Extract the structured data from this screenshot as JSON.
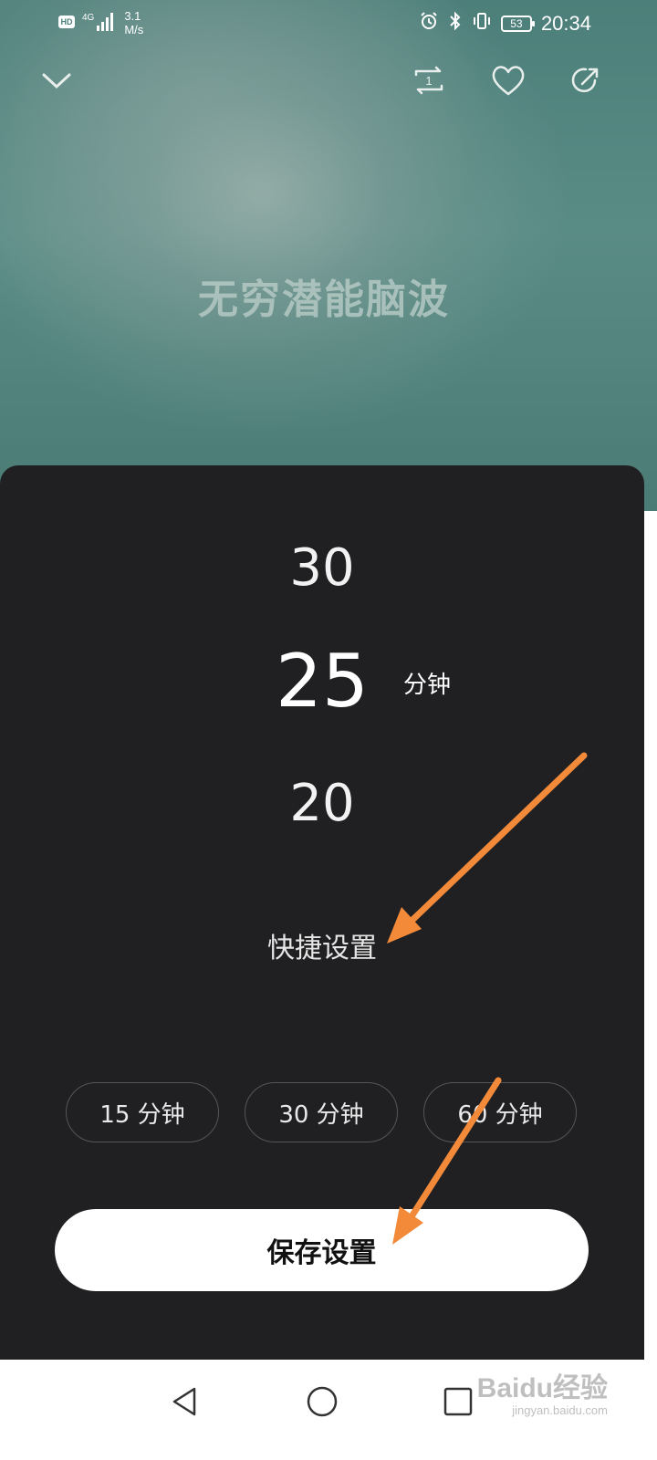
{
  "status_bar": {
    "hd": "HD",
    "network": "4G",
    "speed_value": "3.1",
    "speed_unit": "M/s",
    "battery": "53",
    "time": "20:34"
  },
  "player": {
    "song_title": "无穷潜能脑波",
    "icons": {
      "collapse": "chevron-down-icon",
      "repeat": "repeat-one-icon",
      "favorite": "heart-icon",
      "share": "share-icon"
    }
  },
  "timer_sheet": {
    "picker": {
      "upper": "30",
      "selected": "25",
      "lower": "20",
      "unit": "分钟"
    },
    "quick_label": "快捷设置",
    "quick_options": [
      "15 分钟",
      "30 分钟",
      "60 分钟"
    ],
    "save_label": "保存设置"
  },
  "watermark": {
    "main": "Baidu经验",
    "sub": "jingyan.baidu.com"
  },
  "colors": {
    "sheet_background": "#202022",
    "background_top": "#4d7f7a",
    "annotation_arrow": "#f28a3a"
  }
}
